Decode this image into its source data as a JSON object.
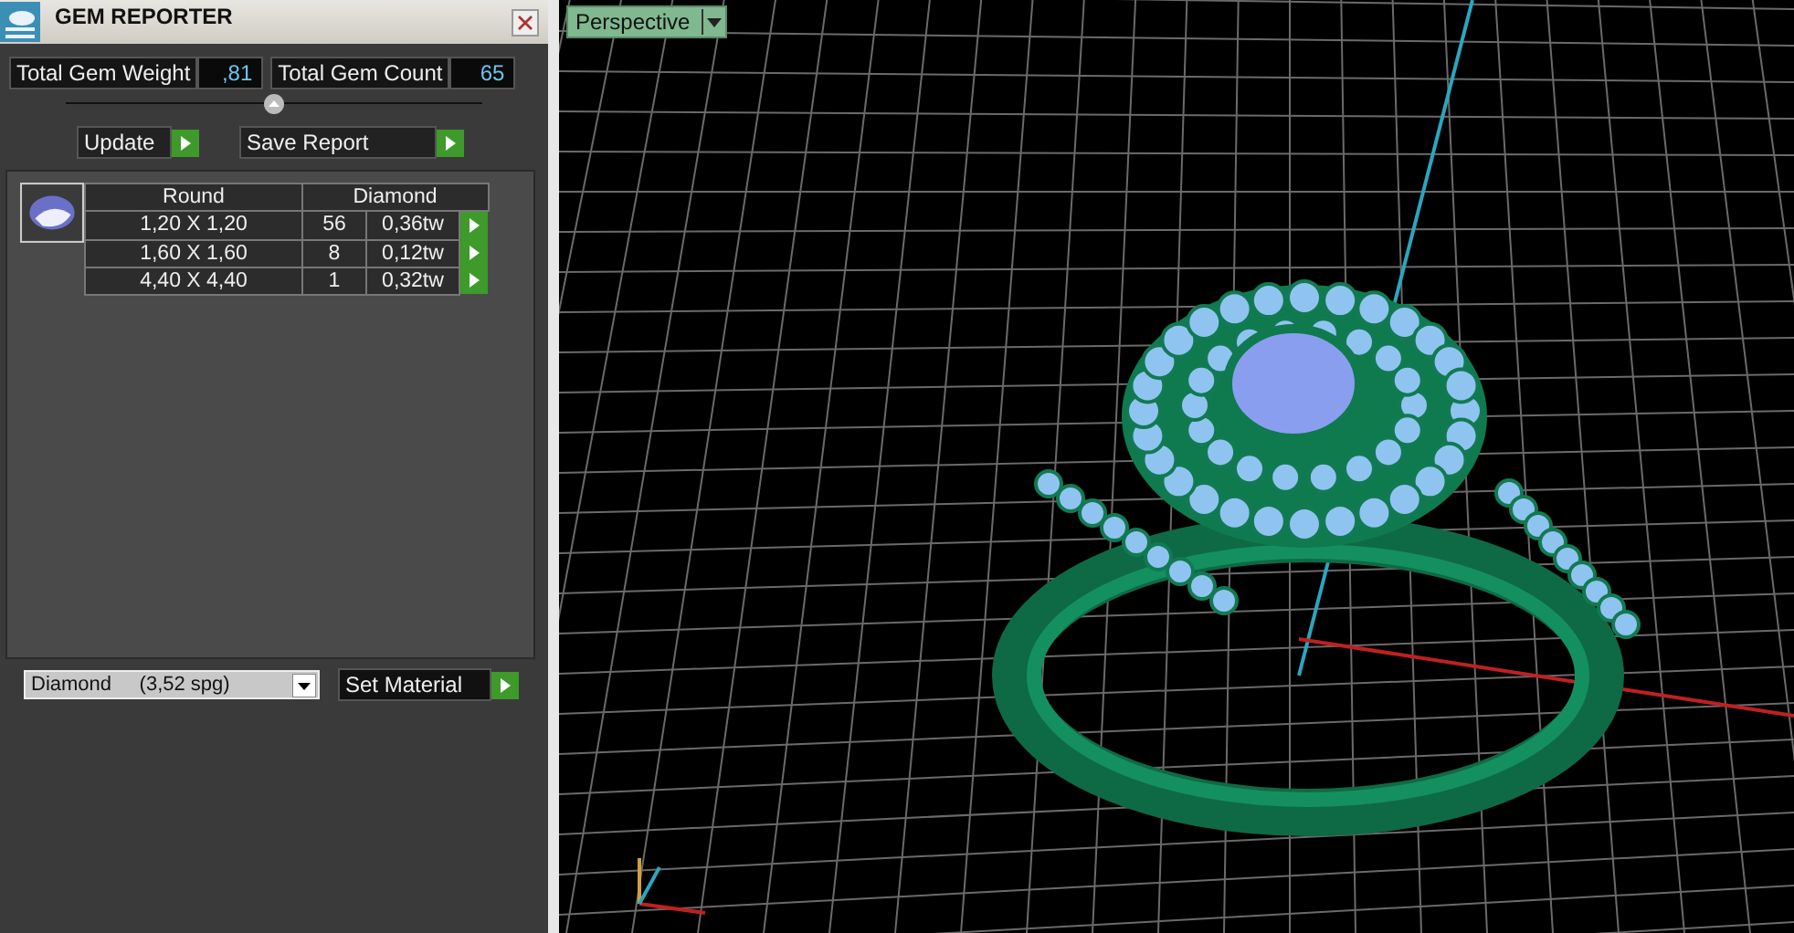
{
  "panel": {
    "title": "GEM REPORTER",
    "total_weight_label": "Total Gem Weight",
    "total_weight": ",81",
    "total_count_label": "Total Gem Count",
    "total_count": "65",
    "update_button": "Update",
    "save_button": "Save Report",
    "gem_table": {
      "columns": [
        "Round",
        "Diamond"
      ],
      "rows": [
        {
          "size": "1,20 X 1,20",
          "count": "56",
          "weight": "0,36tw"
        },
        {
          "size": "1,60 X 1,60",
          "count": "8",
          "weight": "0,12tw"
        },
        {
          "size": "4,40 X 4,40",
          "count": "1",
          "weight": "0,32tw"
        }
      ]
    },
    "material": {
      "value": "Diamond     (3,52 spg)"
    },
    "set_material_button": "Set Material"
  },
  "viewport": {
    "view_menu": "Perspective"
  }
}
